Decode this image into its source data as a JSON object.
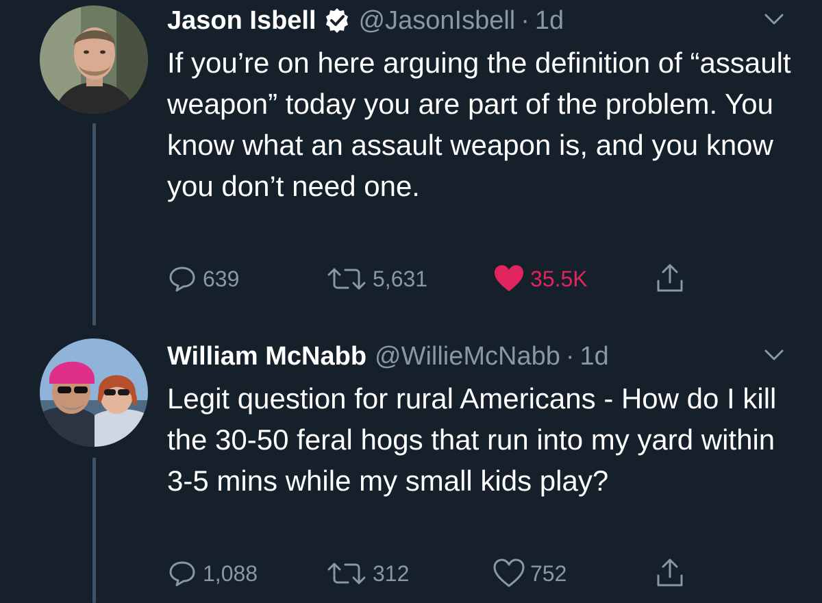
{
  "tweets": [
    {
      "author_name": "Jason Isbell",
      "verified": true,
      "handle": "@JasonIsbell",
      "separator": "·",
      "time": "1d",
      "text": "If you’re on here arguing the definition of “assault weapon” today you are part of the problem. You know what an assault weapon is, and you know you don’t need one.",
      "replies": "639",
      "retweets": "5,631",
      "likes": "35.5K",
      "liked": true
    },
    {
      "author_name": "William McNabb",
      "verified": false,
      "handle": "@WillieMcNabb",
      "separator": "·",
      "time": "1d",
      "text": "Legit question for rural Americans - How do I kill the 30-50 feral hogs that run into my yard within 3-5 mins while my small kids play?",
      "replies": "1,088",
      "retweets": "312",
      "likes": "752",
      "liked": false
    }
  ],
  "colors": {
    "background": "#15202b",
    "text": "#ffffff",
    "secondary": "#8899a6",
    "like_active": "#e0245e",
    "verified_badge": "#ffffff",
    "thread_line": "#3d5466"
  },
  "icons": {
    "verified": "verified-badge-icon",
    "menu": "chevron-down-icon",
    "reply": "reply-bubble-icon",
    "retweet": "retweet-icon",
    "like": "heart-icon",
    "share": "share-upload-icon"
  }
}
